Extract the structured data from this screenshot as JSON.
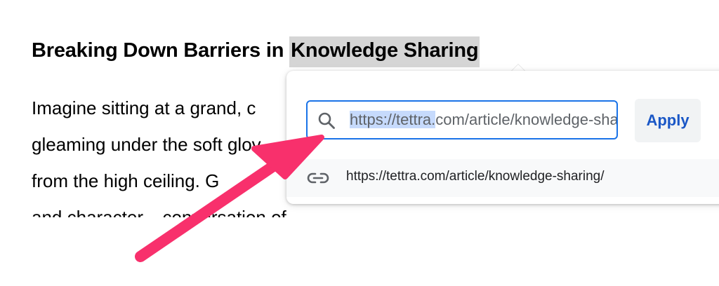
{
  "document": {
    "title_plain": "Breaking Down Barriers in ",
    "title_highlighted": "Knowledge Sharing",
    "paragraph_lines": [
      "Imagine sitting at a grand, c",
      "gleaming under the soft glov",
      "from the high ceiling. G",
      "and character... conversation of"
    ]
  },
  "link_popup": {
    "search": {
      "value_selected": "https://tettra.",
      "value_rest": "com/article/knowledge-sharing/",
      "icon": "search-icon"
    },
    "apply_label": "Apply",
    "suggestion": {
      "icon": "link-icon",
      "url": "https://tettra.com/article/knowledge-sharing/"
    }
  },
  "annotation": {
    "arrow_color": "#f8306c",
    "icon": "arrow-pointer"
  },
  "colors": {
    "focus_border": "#1a73e8",
    "selection": "#c6dafc",
    "apply_text": "#1a57c6",
    "title_highlight": "#d5d5d5"
  }
}
